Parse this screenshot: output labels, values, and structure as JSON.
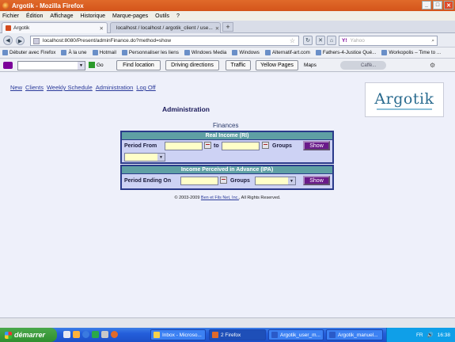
{
  "window": {
    "title": "Argotik - Mozilla Firefox"
  },
  "menu": [
    "Fichier",
    "Édition",
    "Affichage",
    "Historique",
    "Marque-pages",
    "Outils",
    "?"
  ],
  "tabs": [
    {
      "label": "Argotik",
      "active": true
    },
    {
      "label": "localhost / localhost / argotik_client / use...",
      "active": false
    }
  ],
  "nav": {
    "url": "localhost:8080/Present/adminFinance.do?method=show",
    "search_placeholder": "Yahoo"
  },
  "bookmarks": [
    "Débuter avec Firefox",
    "À la une",
    "Hotmail",
    "Personnaliser les liens",
    "Windows Media",
    "Windows",
    "Alternatif-art.com",
    "Fathers-4-Justice Qué...",
    "Workopolis – Time to ..."
  ],
  "yahoo_toolbar": {
    "go_label": "Go",
    "buttons": [
      "Find location",
      "Driving directions",
      "Traffic",
      "Yellow Pages"
    ],
    "maps_label": "Maps",
    "cafe_label": "Caffè..."
  },
  "page": {
    "links": [
      "New",
      "Clients",
      "Weekly Schedule",
      "Administration",
      "Log Off"
    ],
    "logo_text": "Argotik",
    "heading": "Administration",
    "subheading": "Finances",
    "ri": {
      "title": "Real Income (RI)",
      "period_from_label": "Period From",
      "to_label": "to",
      "groups_label": "Groups",
      "show_label": "Show"
    },
    "ipa": {
      "title": "Income Perceived in Advance (IPA)",
      "period_ending_label": "Period Ending On",
      "groups_label": "Groups",
      "show_label": "Show"
    },
    "footer_prefix": "© 2003-2009",
    "footer_link": "Ben et Fils Net, Inc.",
    "footer_suffix": ", All Rights Reserved."
  },
  "taskbar": {
    "start_label": "démarrer",
    "tasks": [
      "Inbox - Microso...",
      "2 Firefox",
      "Argotik_user_m...",
      "Argotik_manuel..."
    ],
    "language": "FR",
    "clock": "16:38"
  },
  "colors": {
    "panel_header": "#5fa0a4",
    "panel_body": "#cdd2f4",
    "show_button": "#6a1a8a",
    "input_bg": "#ffffc8",
    "link": "#2a3a9a",
    "taskbar": "#245edb"
  }
}
